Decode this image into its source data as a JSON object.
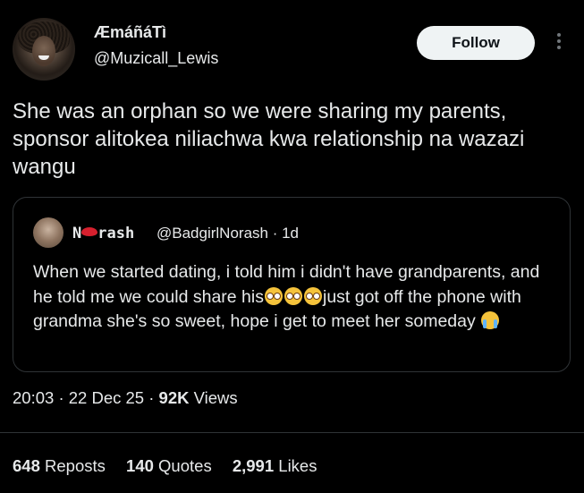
{
  "author": {
    "name": "ÆmáñáTì",
    "handle": "@Muzicall_Lewis"
  },
  "follow_label": "Follow",
  "tweet": {
    "text": "She was an orphan so we were sharing my parents, sponsor alitokea niliachwa kwa relationship na wazazi wangu"
  },
  "quoted": {
    "name_prefix": "N",
    "name_suffix": "rash",
    "handle": "@BadgirlNorash",
    "age": "· 1d",
    "text_part1": "When we started dating, i told him i didn't have grandparents, and he told me we could share his",
    "text_part2": "just got off the phone with grandma she's so sweet, hope i get to meet her someday",
    "emojis": [
      "pleading-face",
      "pleading-face",
      "pleading-face",
      "crying-face"
    ],
    "name_emoji": "lips-icon"
  },
  "meta": {
    "time": "20:03",
    "date": "22 Dec 25",
    "views_count": "92K",
    "views_label": "Views",
    "sep": "·"
  },
  "stats": {
    "reposts_count": "648",
    "reposts_label": "Reposts",
    "quotes_count": "140",
    "quotes_label": "Quotes",
    "likes_count": "2,991",
    "likes_label": "Likes"
  }
}
